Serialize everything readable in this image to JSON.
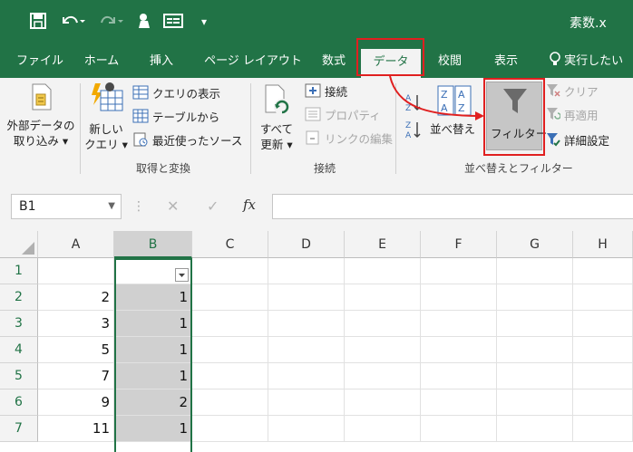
{
  "window": {
    "title": "素数.x"
  },
  "quick_access": {
    "save": "save-icon",
    "undo": "undo-icon",
    "redo": "redo-icon"
  },
  "tabs": [
    {
      "label": "ファイル"
    },
    {
      "label": "ホーム"
    },
    {
      "label": "挿入"
    },
    {
      "label": "ページ レイアウト"
    },
    {
      "label": "数式"
    },
    {
      "label": "データ",
      "active": true
    },
    {
      "label": "校閲"
    },
    {
      "label": "表示"
    },
    {
      "label": "実行したい"
    }
  ],
  "ribbon": {
    "get_external": {
      "line1": "外部データの",
      "line2": "取り込み ▾"
    },
    "new_query": {
      "line1": "新しい",
      "line2": "クエリ ▾"
    },
    "show_queries": "クエリの表示",
    "from_table": "テーブルから",
    "recent_sources": "最近使ったソース",
    "group_get_transform": "取得と変換",
    "refresh_all": {
      "line1": "すべて",
      "line2": "更新 ▾"
    },
    "connections": "接続",
    "properties": "プロパティ",
    "edit_links": "リンクの編集",
    "group_connections": "接続",
    "sort_label": "並べ替え",
    "filter_label": "フィルター",
    "clear": "クリア",
    "reapply": "再適用",
    "advanced": "詳細設定",
    "group_sort_filter": "並べ替えとフィルター"
  },
  "formula_bar": {
    "name_box": "B1",
    "value": ""
  },
  "columns": [
    "A",
    "B",
    "C",
    "D",
    "E",
    "F",
    "G",
    "H"
  ],
  "selected_column": "B",
  "rows": [
    {
      "n": "1",
      "a": "",
      "b": ""
    },
    {
      "n": "2",
      "a": "2",
      "b": "1"
    },
    {
      "n": "3",
      "a": "3",
      "b": "1"
    },
    {
      "n": "4",
      "a": "5",
      "b": "1"
    },
    {
      "n": "5",
      "a": "7",
      "b": "1"
    },
    {
      "n": "6",
      "a": "9",
      "b": "2"
    },
    {
      "n": "7",
      "a": "11",
      "b": "1"
    }
  ],
  "colors": {
    "excel_green": "#217346",
    "highlight_red": "#e02020"
  }
}
